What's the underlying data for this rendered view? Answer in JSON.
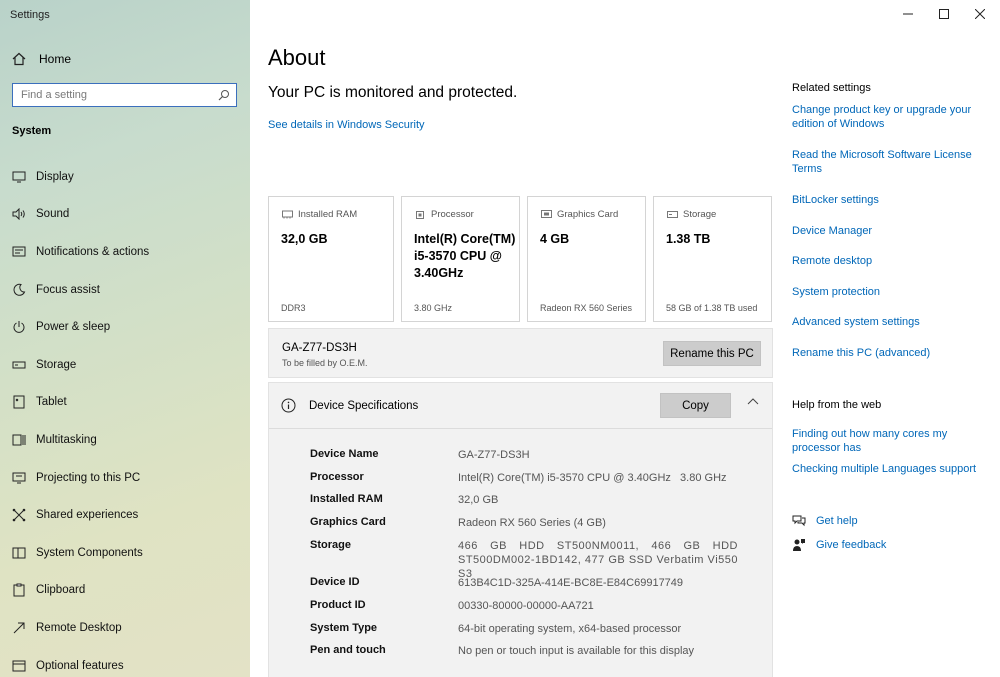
{
  "window": {
    "title": "Settings"
  },
  "sidebar": {
    "home_label": "Home",
    "search_placeholder": "Find a setting",
    "section_label": "System",
    "items": [
      {
        "label": "Display",
        "icon": "monitor-icon"
      },
      {
        "label": "Sound",
        "icon": "speaker-icon"
      },
      {
        "label": "Notifications & actions",
        "icon": "notification-icon"
      },
      {
        "label": "Focus assist",
        "icon": "moon-icon"
      },
      {
        "label": "Power & sleep",
        "icon": "power-icon"
      },
      {
        "label": "Storage",
        "icon": "storage-icon"
      },
      {
        "label": "Tablet",
        "icon": "tablet-icon"
      },
      {
        "label": "Multitasking",
        "icon": "multitasking-icon"
      },
      {
        "label": "Projecting to this PC",
        "icon": "projector-icon"
      },
      {
        "label": "Shared experiences",
        "icon": "shared-icon"
      },
      {
        "label": "System Components",
        "icon": "components-icon"
      },
      {
        "label": "Clipboard",
        "icon": "clipboard-icon"
      },
      {
        "label": "Remote Desktop",
        "icon": "remote-icon"
      },
      {
        "label": "Optional features",
        "icon": "features-icon"
      }
    ]
  },
  "main": {
    "title": "About",
    "protection_status": "Your PC is monitored and protected.",
    "security_link": "See details in Windows Security",
    "cards": [
      {
        "label": "Installed RAM",
        "value": "32,0 GB",
        "sub": "DDR3",
        "icon": "ram-icon"
      },
      {
        "label": "Processor",
        "value": "Intel(R) Core(TM) i5-3570 CPU @ 3.40GHz",
        "sub": "3.80 GHz",
        "icon": "processor-icon"
      },
      {
        "label": "Graphics Card",
        "value": "4 GB",
        "sub": "Radeon RX 560 Series",
        "icon": "graphics-card-icon"
      },
      {
        "label": "Storage",
        "value": "1.38 TB",
        "sub": "58 GB of 1.38 TB used",
        "icon": "storage-drive-icon"
      }
    ],
    "pc_name": "GA-Z77-DS3H",
    "pc_subtitle": "To be filled by O.E.M.",
    "rename_button": "Rename this PC",
    "specs_header": "Device Specifications",
    "copy_button": "Copy",
    "specs": [
      {
        "key": "Device Name",
        "value": "GA-Z77-DS3H"
      },
      {
        "key": "Processor",
        "value": "Intel(R) Core(TM) i5-3570 CPU @ 3.40GHz   3.80 GHz"
      },
      {
        "key": "Installed RAM",
        "value": "32,0 GB"
      },
      {
        "key": "Graphics Card",
        "value": "Radeon RX 560 Series (4 GB)"
      },
      {
        "key": "Storage",
        "value": "466 GB HDD ST500NM0011, 466 GB HDD ST500DM002-1BD142, 477 GB SSD Verbatim Vi550 S3"
      },
      {
        "key": "Device ID",
        "value": "613B4C1D-325A-414E-BC8E-E84C69917749"
      },
      {
        "key": "Product ID",
        "value": "00330-80000-00000-AA721"
      },
      {
        "key": "System Type",
        "value": "64-bit operating system, x64-based processor"
      },
      {
        "key": "Pen and touch",
        "value": "No pen or touch input is available for this display"
      }
    ]
  },
  "right": {
    "related_header": "Related settings",
    "related_links": [
      "Change product key or upgrade your edition of Windows",
      "Read the Microsoft Software License Terms",
      "BitLocker settings",
      "Device Manager",
      "Remote desktop",
      "System protection",
      "Advanced system settings",
      "Rename this PC (advanced)"
    ],
    "help_header": "Help from the web",
    "help_links": [
      "Finding out how many cores my processor has",
      "Checking multiple Languages support"
    ],
    "get_help": "Get help",
    "give_feedback": "Give feedback"
  },
  "colors": {
    "link": "#0067b8",
    "search_border": "#3b6fbd",
    "button": "#cccccc",
    "panel": "#f2f2f2"
  }
}
